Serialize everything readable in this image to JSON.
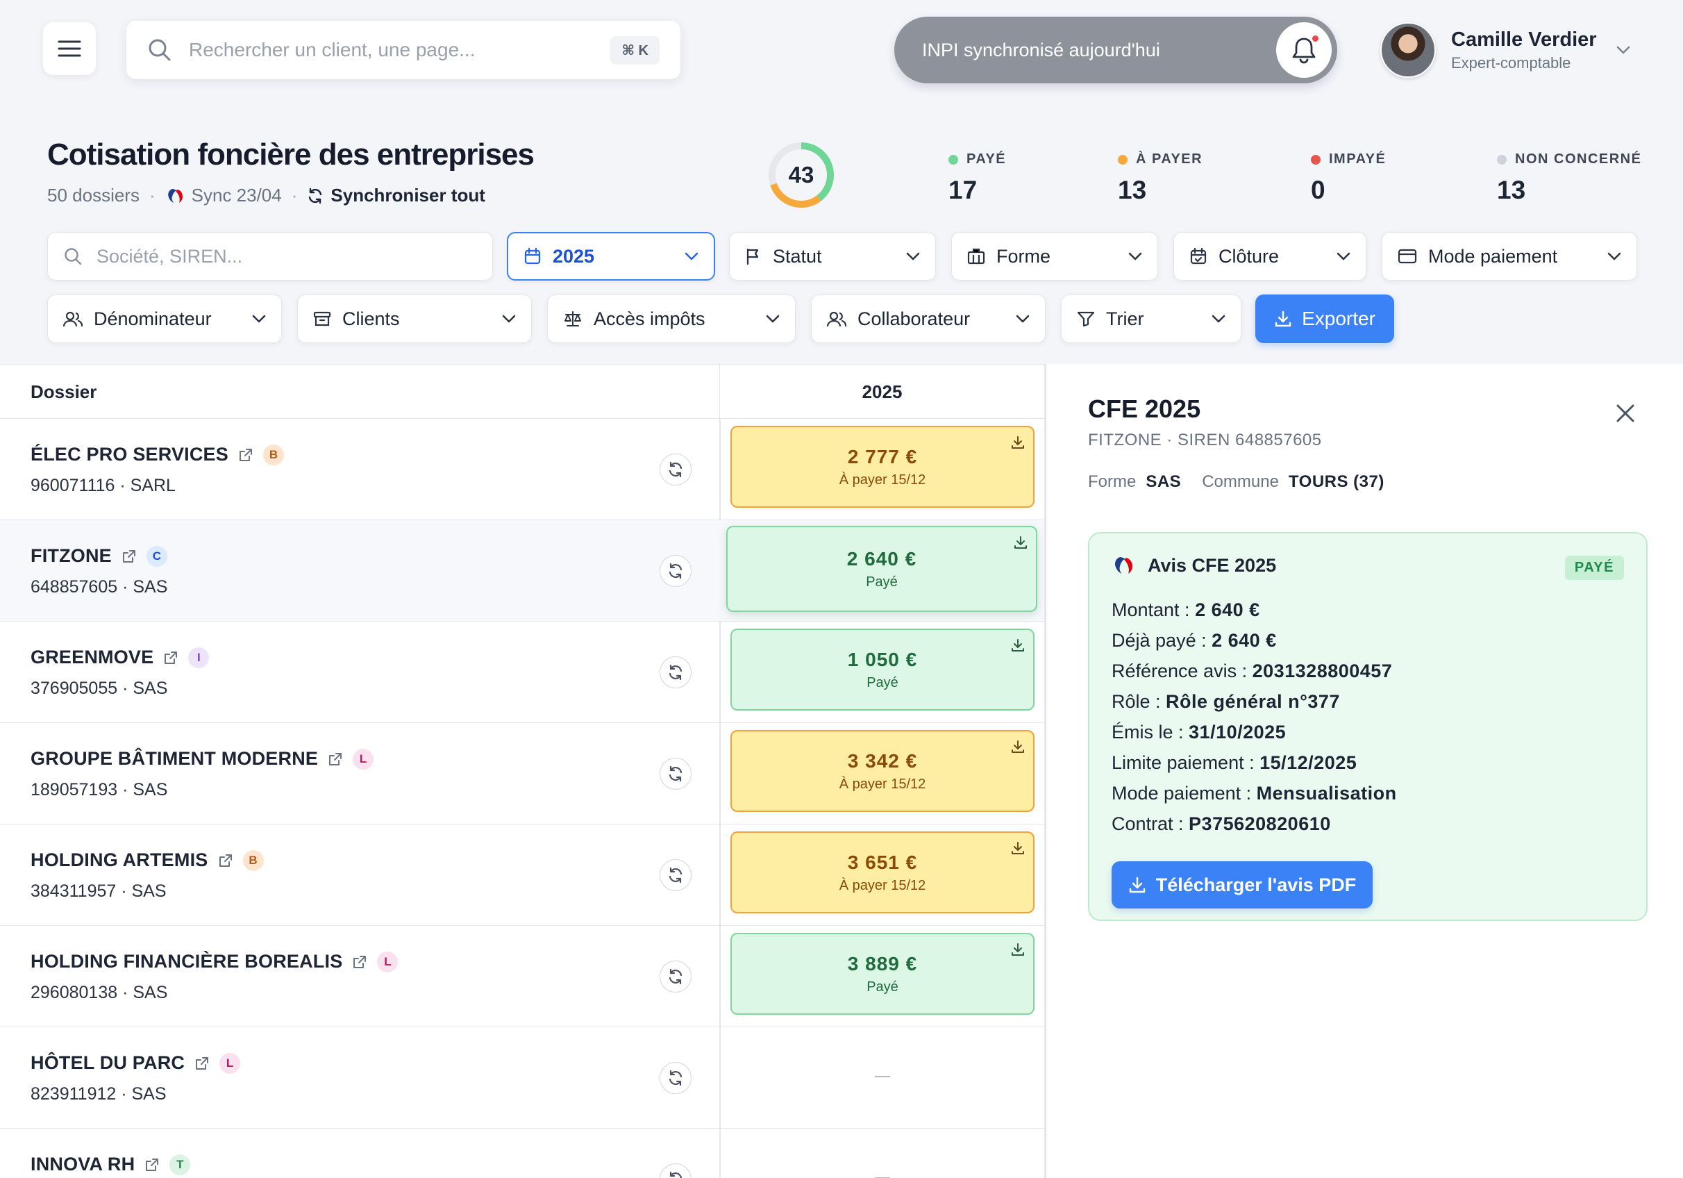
{
  "search": {
    "placeholder": "Rechercher un client, une page...",
    "shortcut": "⌘ K"
  },
  "notification": {
    "text": "INPI synchronisé aujourd'hui"
  },
  "user": {
    "name": "Camille Verdier",
    "role": "Expert-comptable"
  },
  "header": {
    "title": "Cotisation foncière des entreprises",
    "dossier_count": "50 dossiers",
    "sync_date": "Sync 23/04",
    "sync_all": "Synchroniser tout",
    "donut_total": "43"
  },
  "stats": [
    {
      "label": "PAYÉ",
      "value": "17",
      "color": "#6fd695"
    },
    {
      "label": "À PAYER",
      "value": "13",
      "color": "#f4a93a"
    },
    {
      "label": "IMPAYÉ",
      "value": "0",
      "color": "#e5564b"
    },
    {
      "label": "NON CONCERNÉ",
      "value": "13",
      "color": "#cfd2d8"
    }
  ],
  "filters": {
    "search_placeholder": "Société, SIREN...",
    "year": "2025",
    "statut": "Statut",
    "forme": "Forme",
    "cloture": "Clôture",
    "mode_paiement": "Mode paiement",
    "denominateur": "Dénominateur",
    "clients": "Clients",
    "acces_impots": "Accès impôts",
    "collaborateur": "Collaborateur",
    "trier": "Trier",
    "export": "Exporter"
  },
  "table": {
    "col_dossier": "Dossier",
    "col_year": "2025",
    "rows": [
      {
        "name": "ÉLEC PRO SERVICES",
        "badge": "B",
        "meta": "960071116 · SARL",
        "amount": "2 777 €",
        "status": "À payer 15/12"
      },
      {
        "name": "FITZONE",
        "badge": "C",
        "meta": "648857605 · SAS",
        "amount": "2 640 €",
        "status": "Payé"
      },
      {
        "name": "GREENMOVE",
        "badge": "I",
        "meta": "376905055 · SAS",
        "amount": "1 050 €",
        "status": "Payé"
      },
      {
        "name": "GROUPE BÂTIMENT MODERNE",
        "badge": "L",
        "meta": "189057193 · SAS",
        "amount": "3 342 €",
        "status": "À payer 15/12"
      },
      {
        "name": "HOLDING ARTEMIS",
        "badge": "B",
        "meta": "384311957 · SAS",
        "amount": "3 651 €",
        "status": "À payer 15/12"
      },
      {
        "name": "HOLDING FINANCIÈRE BOREALIS",
        "badge": "L",
        "meta": "296080138 · SAS",
        "amount": "3 889 €",
        "status": "Payé"
      },
      {
        "name": "HÔTEL DU PARC",
        "badge": "L",
        "meta": "823911912 · SAS",
        "amount": "—",
        "status": ""
      },
      {
        "name": "INNOVA RH",
        "badge": "T",
        "meta": "",
        "amount": "—",
        "status": ""
      }
    ]
  },
  "panel": {
    "title": "CFE 2025",
    "subtitle": "FITZONE · SIREN 648857605",
    "forme_label": "Forme",
    "forme_value": "SAS",
    "commune_label": "Commune",
    "commune_value": "TOURS (37)",
    "avis_title": "Avis CFE 2025",
    "avis_status": "PAYÉ",
    "lines": [
      {
        "k": "Montant : ",
        "v": "2 640 €"
      },
      {
        "k": "Déjà payé : ",
        "v": "2 640 €"
      },
      {
        "k": "Référence avis : ",
        "v": "2031328800457"
      },
      {
        "k": "Rôle : ",
        "v": "Rôle général n°377"
      },
      {
        "k": "Émis le : ",
        "v": "31/10/2025"
      },
      {
        "k": "Limite paiement : ",
        "v": "15/12/2025"
      },
      {
        "k": "Mode paiement : ",
        "v": "Mensualisation"
      },
      {
        "k": "Contrat : ",
        "v": "P375620820610"
      }
    ],
    "download": "Télécharger l'avis PDF"
  },
  "colors": {
    "accent": "#3b82f6",
    "due_bg": "#fdeea3",
    "paid_bg": "#dcf7e5"
  }
}
